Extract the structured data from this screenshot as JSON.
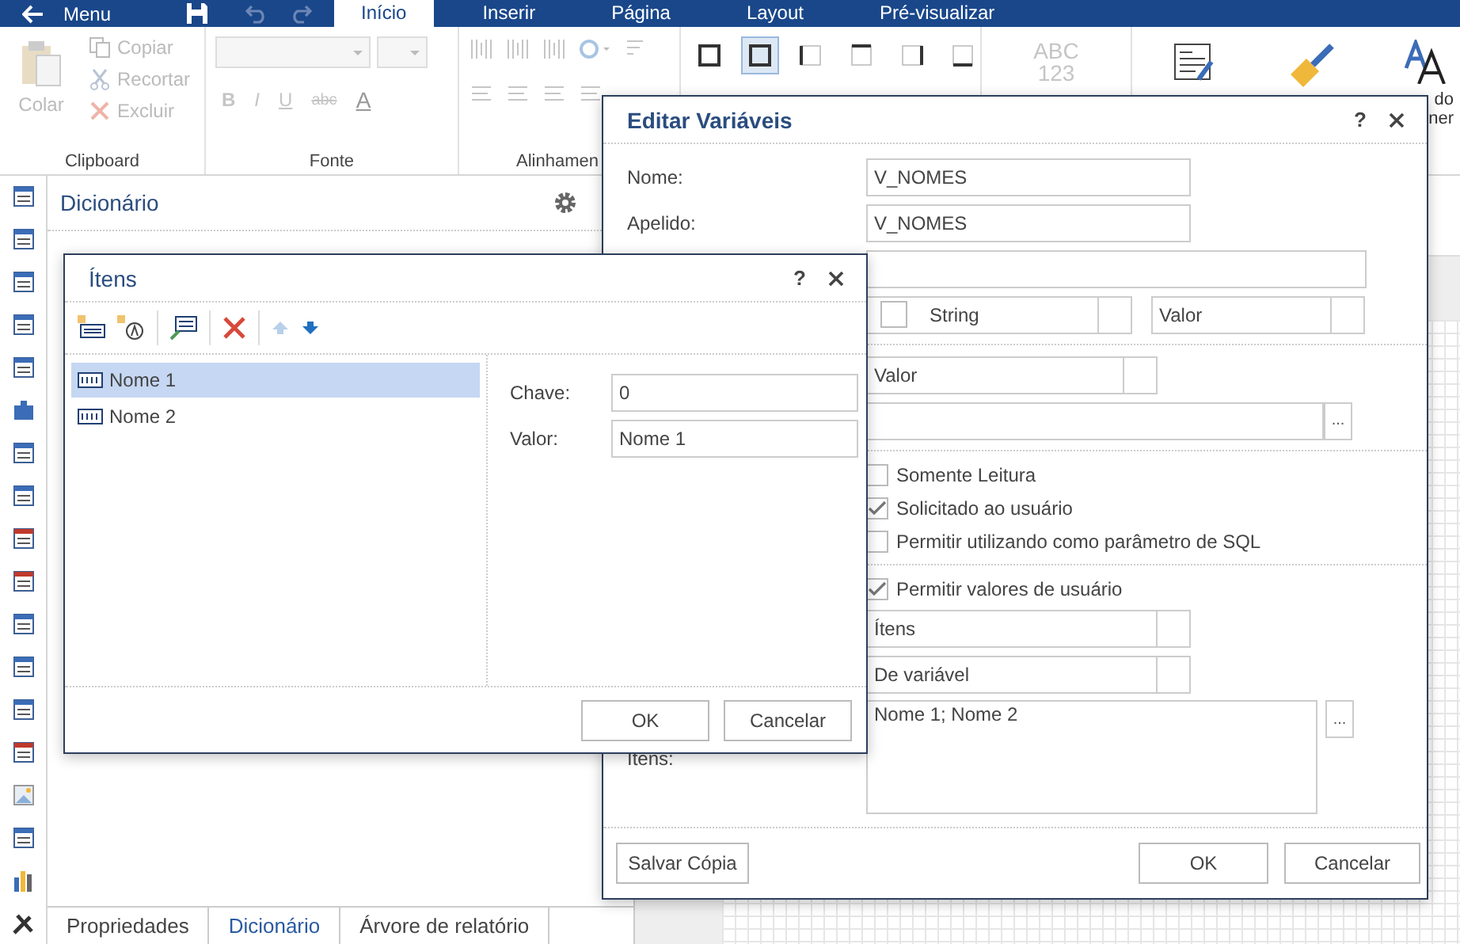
{
  "top_bar": {
    "back_label": "Menu",
    "tabs": [
      {
        "label": "Início",
        "selected": true
      },
      {
        "label": "Inserir",
        "selected": false
      },
      {
        "label": "Página",
        "selected": false
      },
      {
        "label": "Layout",
        "selected": false
      },
      {
        "label": "Pré-visualizar",
        "selected": false
      }
    ]
  },
  "ribbon": {
    "clipboard": {
      "label": "Clipboard",
      "paste": {
        "label": "Colar",
        "disabled": true
      },
      "actions": [
        {
          "label": "Copiar",
          "kind": "copy",
          "disabled": true
        },
        {
          "label": "Recortar",
          "kind": "cut",
          "disabled": true
        },
        {
          "label": "Excluir",
          "kind": "delete",
          "disabled": true
        }
      ]
    },
    "font": {
      "label": "Fonte",
      "format_buttons": [
        "B",
        "I",
        "U",
        "abc",
        "A"
      ]
    },
    "alignment": {
      "label": "Alinhamen"
    },
    "borders": [
      {
        "kind": "all",
        "selected": false
      },
      {
        "kind": "all",
        "selected": true
      },
      {
        "kind": "left",
        "selected": false
      },
      {
        "kind": "top",
        "selected": false
      },
      {
        "kind": "right",
        "selected": false
      },
      {
        "kind": "bottom",
        "selected": false
      }
    ],
    "format_icon": [
      "ABC",
      "123"
    ],
    "style_label": [
      "do",
      "ner"
    ]
  },
  "dictionary": {
    "title": "Dicionário"
  },
  "panel_tabs": [
    {
      "label": "Propriedades",
      "selected": false
    },
    {
      "label": "Dicionário",
      "selected": true
    },
    {
      "label": "Árvore de relatório",
      "selected": false
    }
  ],
  "edit_dialog": {
    "title": "Editar Variáveis",
    "name_label": "Nome:",
    "name": "V_NOMES",
    "alias_label": "Apelido:",
    "alias": "V_NOMES",
    "type_checked": false,
    "type": "String",
    "value_mode": "Valor",
    "init_mode": "Valor",
    "checkboxes": [
      {
        "label": "Somente Leitura",
        "checked": false
      },
      {
        "label": "Solicitado ao usuário",
        "checked": true
      },
      {
        "label": "Permitir utilizando como parâmetro de SQL",
        "checked": false
      }
    ],
    "allow_user_values": {
      "label": "Permitir valores de usuário",
      "checked": true
    },
    "items_source": "Ítens",
    "items_from": "De variável",
    "items_label": "Itens:",
    "items_value": "Nome 1; Nome 2",
    "buttons": {
      "save_copy": "Salvar Cópia",
      "ok": "OK",
      "cancel": "Cancelar"
    },
    "help": "?",
    "browse_buttons": [
      "...",
      "..."
    ]
  },
  "items_dialog": {
    "title": "Ítens",
    "list": [
      {
        "label": "Nome 1",
        "selected": true
      },
      {
        "label": "Nome 2",
        "selected": false
      }
    ],
    "key_label": "Chave:",
    "key": "0",
    "value_label": "Valor:",
    "value": "Nome 1",
    "ok": "OK",
    "cancel": "Cancelar",
    "help": "?"
  }
}
